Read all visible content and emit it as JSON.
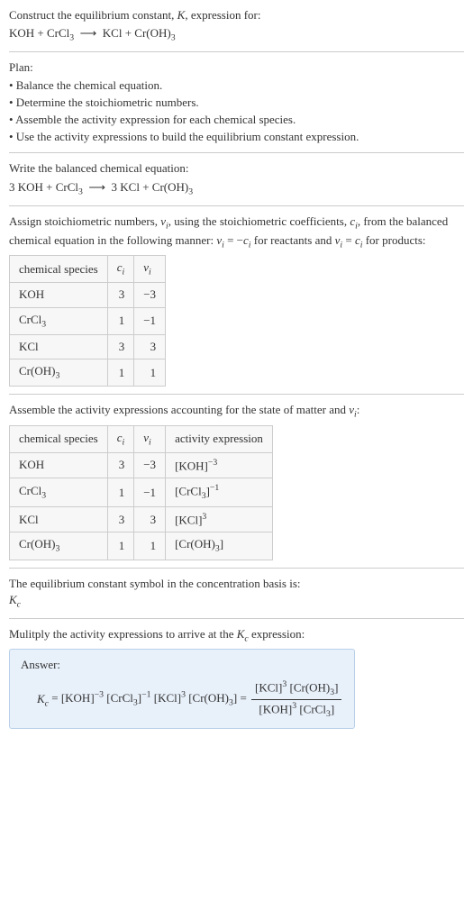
{
  "title": "Construct the equilibrium constant, K, expression for:",
  "equation_unbalanced": "KOH + CrCl₃ ⟶ KCl + Cr(OH)₃",
  "plan_label": "Plan:",
  "plan_items": [
    "• Balance the chemical equation.",
    "• Determine the stoichiometric numbers.",
    "• Assemble the activity expression for each chemical species.",
    "• Use the activity expressions to build the equilibrium constant expression."
  ],
  "balanced_label": "Write the balanced chemical equation:",
  "equation_balanced": "3 KOH + CrCl₃ ⟶ 3 KCl + Cr(OH)₃",
  "stoich_intro_a": "Assign stoichiometric numbers, νᵢ, using the stoichiometric coefficients, cᵢ, from the balanced chemical equation in the following manner: νᵢ = −cᵢ for reactants and νᵢ = cᵢ for products:",
  "table1": {
    "headers": [
      "chemical species",
      "cᵢ",
      "νᵢ"
    ],
    "rows": [
      [
        "KOH",
        "3",
        "−3"
      ],
      [
        "CrCl₃",
        "1",
        "−1"
      ],
      [
        "KCl",
        "3",
        "3"
      ],
      [
        "Cr(OH)₃",
        "1",
        "1"
      ]
    ]
  },
  "activity_intro": "Assemble the activity expressions accounting for the state of matter and νᵢ:",
  "table2": {
    "headers": [
      "chemical species",
      "cᵢ",
      "νᵢ",
      "activity expression"
    ],
    "rows": [
      [
        "KOH",
        "3",
        "−3",
        "[KOH]⁻³"
      ],
      [
        "CrCl₃",
        "1",
        "−1",
        "[CrCl₃]⁻¹"
      ],
      [
        "KCl",
        "3",
        "3",
        "[KCl]³"
      ],
      [
        "Cr(OH)₃",
        "1",
        "1",
        "[Cr(OH)₃]"
      ]
    ]
  },
  "kc_symbol_label": "The equilibrium constant symbol in the concentration basis is:",
  "kc_symbol": "K_c",
  "multiply_label": "Mulitply the activity expressions to arrive at the K_c expression:",
  "answer_label": "Answer:",
  "answer_lhs": "K_c = [KOH]⁻³ [CrCl₃]⁻¹ [KCl]³ [Cr(OH)₃] = ",
  "answer_frac_num": "[KCl]³ [Cr(OH)₃]",
  "answer_frac_den": "[KOH]³ [CrCl₃]"
}
